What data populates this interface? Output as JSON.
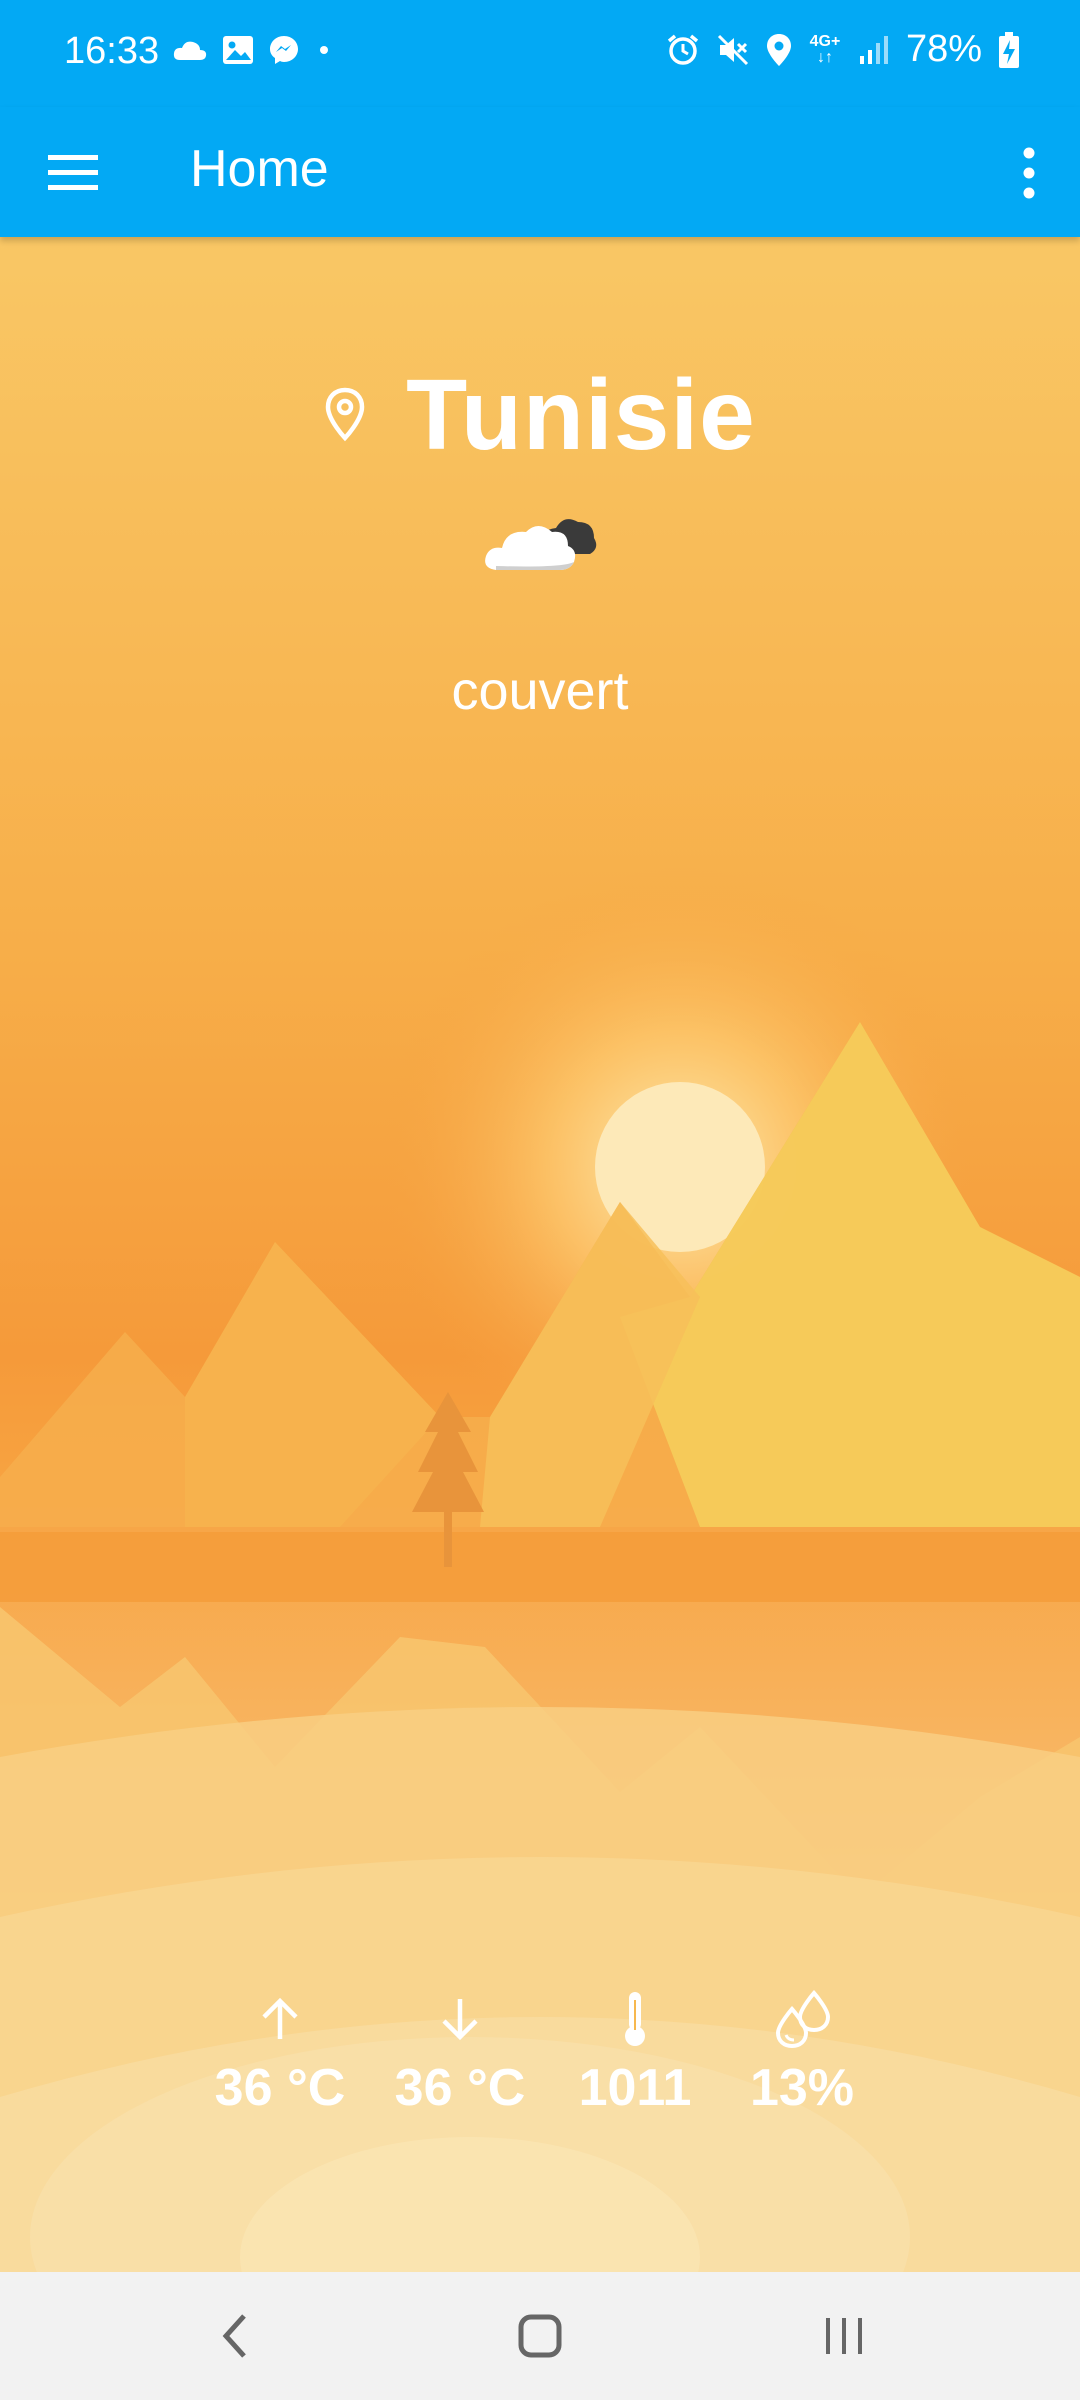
{
  "status_bar": {
    "time": "16:33",
    "left_icons": [
      "cloud-icon",
      "image-icon",
      "messenger-icon",
      "dot-icon"
    ],
    "network": "4G+",
    "battery": "78%",
    "right_icons": [
      "alarm-icon",
      "mute-icon",
      "location-icon",
      "network-icon",
      "signal-icon",
      "battery-charging-icon"
    ]
  },
  "app_bar": {
    "title": "Home",
    "menu_icon": "hamburger-menu-icon",
    "overflow_icon": "more-vert-icon",
    "color": "#03a9f4"
  },
  "weather": {
    "city": "Tunisie",
    "condition": "couvert",
    "icon": "overcast-cloud-icon",
    "stats": [
      {
        "icon": "arrow-up-icon",
        "value": "36 °C"
      },
      {
        "icon": "arrow-down-icon",
        "value": "36 °C"
      },
      {
        "icon": "thermometer-icon",
        "value": "1011"
      },
      {
        "icon": "humidity-icon",
        "value": "13%"
      }
    ]
  },
  "nav_bar": {
    "back_icon": "back-icon",
    "home_icon": "home-icon",
    "recents_icon": "recents-icon"
  }
}
